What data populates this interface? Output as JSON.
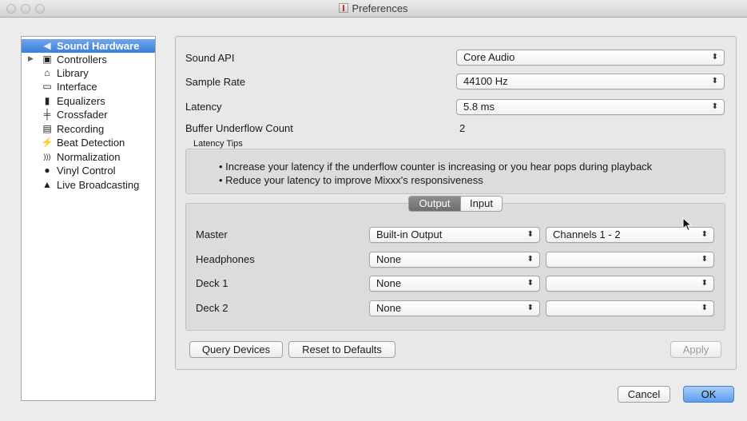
{
  "window": {
    "title": "Preferences"
  },
  "sidebar": {
    "items": [
      {
        "label": "Sound Hardware",
        "icon": "speaker-icon",
        "glyph": "◀",
        "selected": true,
        "expandable": false
      },
      {
        "label": "Controllers",
        "icon": "controller-icon",
        "glyph": "▣",
        "selected": false,
        "expandable": true
      },
      {
        "label": "Library",
        "icon": "library-icon",
        "glyph": "⌂",
        "selected": false,
        "expandable": false
      },
      {
        "label": "Interface",
        "icon": "monitor-icon",
        "glyph": "▭",
        "selected": false,
        "expandable": false
      },
      {
        "label": "Equalizers",
        "icon": "equalizer-icon",
        "glyph": "▮",
        "selected": false,
        "expandable": false
      },
      {
        "label": "Crossfader",
        "icon": "crossfader-icon",
        "glyph": "╪",
        "selected": false,
        "expandable": false
      },
      {
        "label": "Recording",
        "icon": "recording-icon",
        "glyph": "▤",
        "selected": false,
        "expandable": false
      },
      {
        "label": "Beat Detection",
        "icon": "beat-detection-icon",
        "glyph": "⚡",
        "selected": false,
        "expandable": false
      },
      {
        "label": "Normalization",
        "icon": "normalization-icon",
        "glyph": ")))",
        "selected": false,
        "expandable": false
      },
      {
        "label": "Vinyl Control",
        "icon": "vinyl-icon",
        "glyph": "●",
        "selected": false,
        "expandable": false
      },
      {
        "label": "Live Broadcasting",
        "icon": "broadcast-icon",
        "glyph": "▲",
        "selected": false,
        "expandable": false
      }
    ]
  },
  "sound": {
    "api_label": "Sound API",
    "api_value": "Core Audio",
    "rate_label": "Sample Rate",
    "rate_value": "44100 Hz",
    "latency_label": "Latency",
    "latency_value": "5.8 ms",
    "underflow_label": "Buffer Underflow Count",
    "underflow_value": "2"
  },
  "tips": {
    "heading": "Latency Tips",
    "line1": "• Increase your latency if the underflow counter is increasing or you hear pops during playback",
    "line2": "• Reduce your latency to improve Mixxx's responsiveness"
  },
  "tabs": {
    "output": "Output",
    "input": "Input",
    "active": "Output"
  },
  "outputs": [
    {
      "label": "Master",
      "device": "Built-in Output",
      "channels": "Channels 1 - 2"
    },
    {
      "label": "Headphones",
      "device": "None",
      "channels": ""
    },
    {
      "label": "Deck 1",
      "device": "None",
      "channels": ""
    },
    {
      "label": "Deck 2",
      "device": "None",
      "channels": ""
    }
  ],
  "buttons": {
    "query": "Query Devices",
    "reset": "Reset to Defaults",
    "apply": "Apply",
    "cancel": "Cancel",
    "ok": "OK"
  },
  "colors": {
    "selection": "#3d7fdb",
    "default_button": "#5a9df0"
  }
}
